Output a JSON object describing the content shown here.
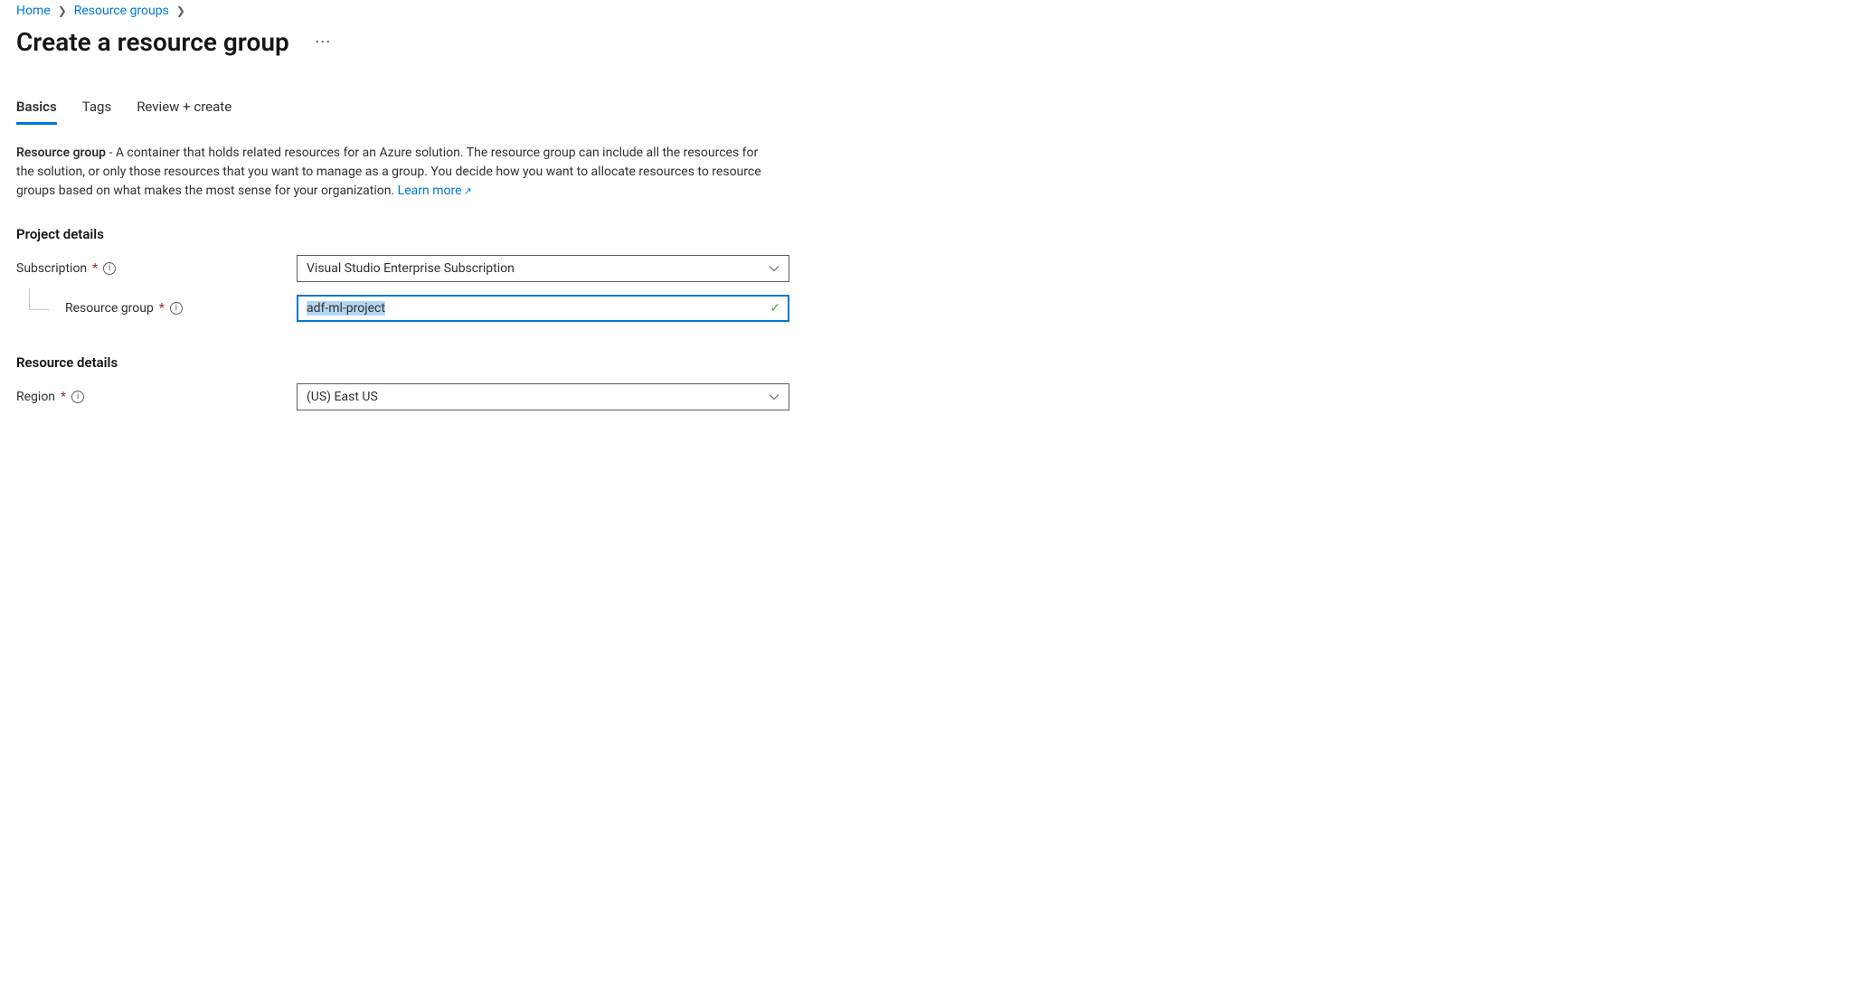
{
  "breadcrumb": {
    "home": "Home",
    "resource_groups": "Resource groups"
  },
  "page_title": "Create a resource group",
  "tabs": {
    "basics": "Basics",
    "tags": "Tags",
    "review": "Review + create"
  },
  "description": {
    "lead": "Resource group",
    "body": " - A container that holds related resources for an Azure solution. The resource group can include all the resources for the solution, or only those resources that you want to manage as a group. You decide how you want to allocate resources to resource groups based on what makes the most sense for your organization. ",
    "learn_more": "Learn more"
  },
  "sections": {
    "project_details": "Project details",
    "resource_details": "Resource details"
  },
  "fields": {
    "subscription": {
      "label": "Subscription",
      "value": "Visual Studio Enterprise Subscription"
    },
    "resource_group": {
      "label": "Resource group",
      "value": "adf-ml-project"
    },
    "region": {
      "label": "Region",
      "value": "(US) East US"
    }
  }
}
